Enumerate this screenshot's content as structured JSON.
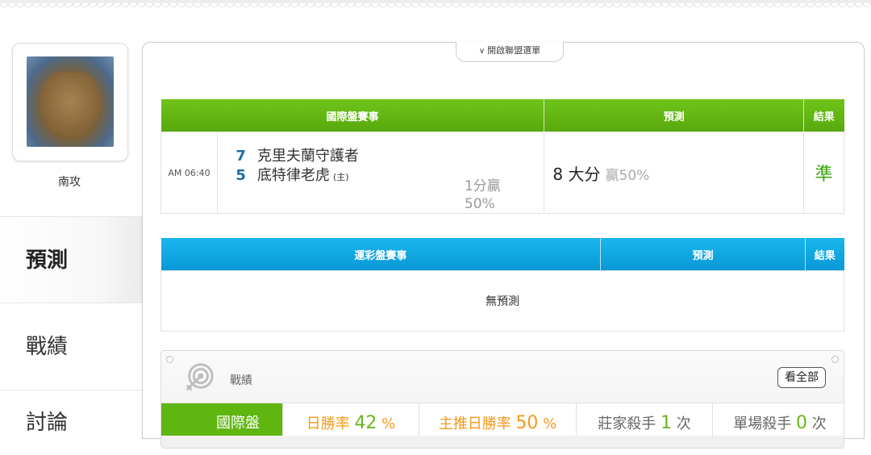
{
  "profile": {
    "username": "南攻"
  },
  "sidebar": {
    "tabs": [
      {
        "label": "預測",
        "active": true
      },
      {
        "label": "戰績",
        "active": false
      },
      {
        "label": "討論",
        "active": false
      }
    ]
  },
  "league_toggle": {
    "label": "開啟聯盟選單"
  },
  "international": {
    "headers": [
      "國際盤賽事",
      "預測",
      "結果"
    ],
    "header_color": "#62b513",
    "games": [
      {
        "time": "AM 06:40",
        "teams": [
          {
            "score": "7",
            "name": "克里夫蘭守護者",
            "host": ""
          },
          {
            "score": "5",
            "name": "底特律老虎",
            "host": "(主)"
          }
        ],
        "handicap_line1": "1分贏",
        "handicap_line2": "50%",
        "prediction_main": "8 大分",
        "prediction_sub": "贏50%",
        "result": "準"
      }
    ]
  },
  "lottery": {
    "headers": [
      "運彩盤賽事",
      "預測",
      "結果"
    ],
    "header_color": "#12a8e3",
    "empty_text": "無預測"
  },
  "record": {
    "title": "戰績",
    "view_all_label": "看全部",
    "stats": [
      {
        "label": "國際盤",
        "value": ""
      },
      {
        "label": "日勝率",
        "value": "42",
        "unit": "%"
      },
      {
        "label": "主推日勝率",
        "value": "50",
        "unit": "%"
      },
      {
        "label": "莊家殺手",
        "value": "1",
        "unit": "次"
      },
      {
        "label": "單場殺手",
        "value": "0",
        "unit": "次"
      }
    ]
  }
}
